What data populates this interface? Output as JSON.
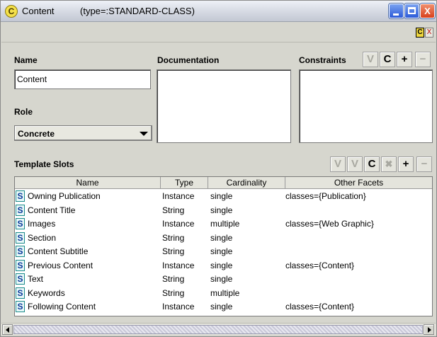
{
  "window": {
    "icon_glyph": "C",
    "title": "Content",
    "type_label": "(type=:STANDARD-CLASS)",
    "minimize_glyph": "_",
    "close_glyph": "X"
  },
  "toolrow": {
    "c_glyph": "C",
    "x_glyph": "X"
  },
  "name": {
    "label": "Name",
    "value": "Content"
  },
  "role": {
    "label": "Role",
    "selected": "Concrete"
  },
  "documentation": {
    "label": "Documentation",
    "value": ""
  },
  "constraints": {
    "label": "Constraints",
    "buttons": {
      "view": "V",
      "create": "C",
      "add": "+",
      "remove": "−"
    }
  },
  "template_slots": {
    "label": "Template Slots",
    "buttons": {
      "view": "V",
      "view_top": "V",
      "create": "C",
      "delete": "✖",
      "add": "+",
      "remove": "−"
    },
    "columns": [
      "Name",
      "Type",
      "Cardinality",
      "Other Facets"
    ],
    "rows": [
      {
        "icon": "S",
        "name": "Owning Publication",
        "type": "Instance",
        "cardinality": "single",
        "facets": "classes={Publication}"
      },
      {
        "icon": "S",
        "name": "Content Title",
        "type": "String",
        "cardinality": "single",
        "facets": ""
      },
      {
        "icon": "S",
        "name": "Images",
        "type": "Instance",
        "cardinality": "multiple",
        "facets": "classes={Web Graphic}"
      },
      {
        "icon": "S",
        "name": "Section",
        "type": "String",
        "cardinality": "single",
        "facets": ""
      },
      {
        "icon": "S",
        "name": "Content Subtitle",
        "type": "String",
        "cardinality": "single",
        "facets": ""
      },
      {
        "icon": "S",
        "name": "Previous Content",
        "type": "Instance",
        "cardinality": "single",
        "facets": "classes={Content}"
      },
      {
        "icon": "S",
        "name": "Text",
        "type": "String",
        "cardinality": "single",
        "facets": ""
      },
      {
        "icon": "S",
        "name": "Keywords",
        "type": "String",
        "cardinality": "multiple",
        "facets": ""
      },
      {
        "icon": "S",
        "name": "Following Content",
        "type": "Instance",
        "cardinality": "single",
        "facets": "classes={Content}"
      }
    ]
  }
}
